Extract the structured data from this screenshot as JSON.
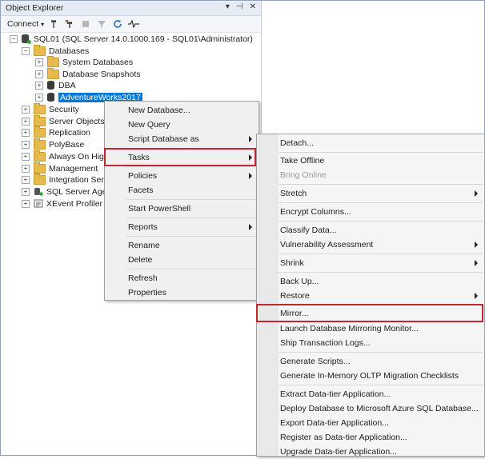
{
  "panel": {
    "title": "Object Explorer",
    "title_icons": [
      "pin-icon",
      "auto-hide-icon",
      "close-icon"
    ],
    "connect_label": "Connect"
  },
  "tree": {
    "server": "SQL01 (SQL Server 14.0.1000.169 - SQL01\\Administrator)",
    "databases": "Databases",
    "system_databases": "System Databases",
    "database_snapshots": "Database Snapshots",
    "dba": "DBA",
    "adventureworks": "AdventureWorks2017",
    "security": "Security",
    "server_objects": "Server Objects",
    "replication": "Replication",
    "polybase": "PolyBase",
    "always_on": "Always On High",
    "management": "Management",
    "integration": "Integration Servi",
    "sql_agent": "SQL Server Agen",
    "xevent": "XEvent Profiler"
  },
  "context_menu": {
    "new_database": "New Database...",
    "new_query": "New Query",
    "script_database_as": "Script Database as",
    "tasks": "Tasks",
    "policies": "Policies",
    "facets": "Facets",
    "start_powershell": "Start PowerShell",
    "reports": "Reports",
    "rename": "Rename",
    "delete": "Delete",
    "refresh": "Refresh",
    "properties": "Properties"
  },
  "tasks_menu": {
    "detach": "Detach...",
    "take_offline": "Take Offline",
    "bring_online": "Bring Online",
    "stretch": "Stretch",
    "encrypt_columns": "Encrypt Columns...",
    "classify_data": "Classify Data...",
    "vulnerability_assessment": "Vulnerability Assessment",
    "shrink": "Shrink",
    "back_up": "Back Up...",
    "restore": "Restore",
    "mirror": "Mirror...",
    "launch_mirroring_monitor": "Launch Database Mirroring Monitor...",
    "ship_transaction_logs": "Ship Transaction Logs...",
    "generate_scripts": "Generate Scripts...",
    "generate_inmemory": "Generate In-Memory OLTP Migration Checklists",
    "extract_dac": "Extract Data-tier Application...",
    "deploy_azure": "Deploy Database to Microsoft Azure SQL Database...",
    "export_dac": "Export Data-tier Application...",
    "register_dac": "Register as Data-tier Application...",
    "upgrade_dac": "Upgrade Data-tier Application..."
  },
  "colors": {
    "highlight_box": "#c0282e",
    "selection": "#0078d7"
  }
}
